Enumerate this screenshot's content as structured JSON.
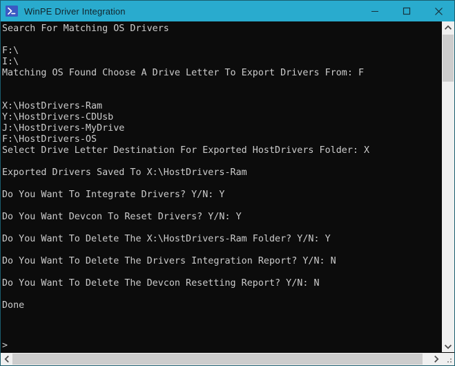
{
  "window": {
    "title": "WinPE Driver Integration",
    "icon": "powershell-icon",
    "titlebar_color": "#29abce",
    "titlebar_text_color": "#12242b",
    "border_color": "#1a5d6e"
  },
  "controls": {
    "minimize": "minimize-icon",
    "maximize": "maximize-icon",
    "close": "close-icon"
  },
  "console": {
    "background": "#0c0c0c",
    "foreground": "#cccccc",
    "prompt": ">",
    "lines": [
      "Search For Matching OS Drivers",
      "",
      "F:\\",
      "I:\\",
      "Matching OS Found Choose A Drive Letter To Export Drivers From: F",
      "",
      "",
      "X:\\HostDrivers-Ram",
      "Y:\\HostDrivers-CDUsb",
      "J:\\HostDrivers-MyDrive",
      "F:\\HostDrivers-OS",
      "Select Drive Letter Destination For Exported HostDrivers Folder: X",
      "",
      "Exported Drivers Saved To X:\\HostDrivers-Ram",
      "",
      "Do You Want To Integrate Drivers? Y/N: Y",
      "",
      "Do You Want Devcon To Reset Drivers? Y/N: Y",
      "",
      "Do You Want To Delete The X:\\HostDrivers-Ram Folder? Y/N: Y",
      "",
      "Do You Want To Delete The Drivers Integration Report? Y/N: N",
      "",
      "Do You Want To Delete The Devcon Resetting Report? Y/N: N",
      "",
      "Done"
    ]
  },
  "scrollbars": {
    "vertical": {
      "up_button": "chevron-up-icon",
      "down_button": "chevron-down-icon",
      "thumb_color": "#cdcdcd",
      "track_color": "#f0f0f0"
    },
    "horizontal": {
      "left_button": "chevron-left-icon",
      "right_button": "chevron-right-icon",
      "thumb_color": "#cdcdcd",
      "track_color": "#f0f0f0"
    },
    "resize_grip": "resize-grip-icon"
  }
}
